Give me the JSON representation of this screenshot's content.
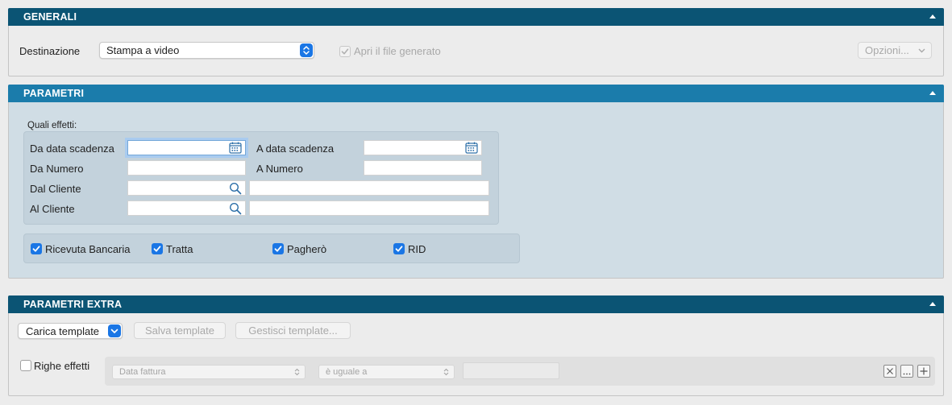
{
  "generali": {
    "title": "GENERALI",
    "destinazione_label": "Destinazione",
    "destinazione_value": "Stampa a video",
    "apri_file_label": "Apri il file generato",
    "opzioni_label": "Opzioni..."
  },
  "parametri": {
    "title": "PARAMETRI",
    "quali_effetti_label": "Quali effetti:",
    "da_data_scadenza_label": "Da data scadenza",
    "a_data_scadenza_label": "A data scadenza",
    "da_numero_label": "Da Numero",
    "a_numero_label": "A Numero",
    "dal_cliente_label": "Dal Cliente",
    "al_cliente_label": "Al Cliente",
    "checkboxes": [
      {
        "label": "Ricevuta Bancaria",
        "checked": true
      },
      {
        "label": "Tratta",
        "checked": true
      },
      {
        "label": "Pagherò",
        "checked": true
      },
      {
        "label": "RID",
        "checked": true
      }
    ]
  },
  "parametri_extra": {
    "title": "PARAMETRI EXTRA",
    "carica_template_label": "Carica template",
    "salva_template_label": "Salva template",
    "gestisci_template_label": "Gestisci template...",
    "righe_effetti_label": "Righe effetti",
    "field_select_value": "Data fattura",
    "operator_select_value": "è uguale a"
  },
  "colors": {
    "header_dark": "#0b5474",
    "header_blue": "#1b7cab",
    "accent": "#1a76e5",
    "parametri_bg": "#d0dde5"
  }
}
